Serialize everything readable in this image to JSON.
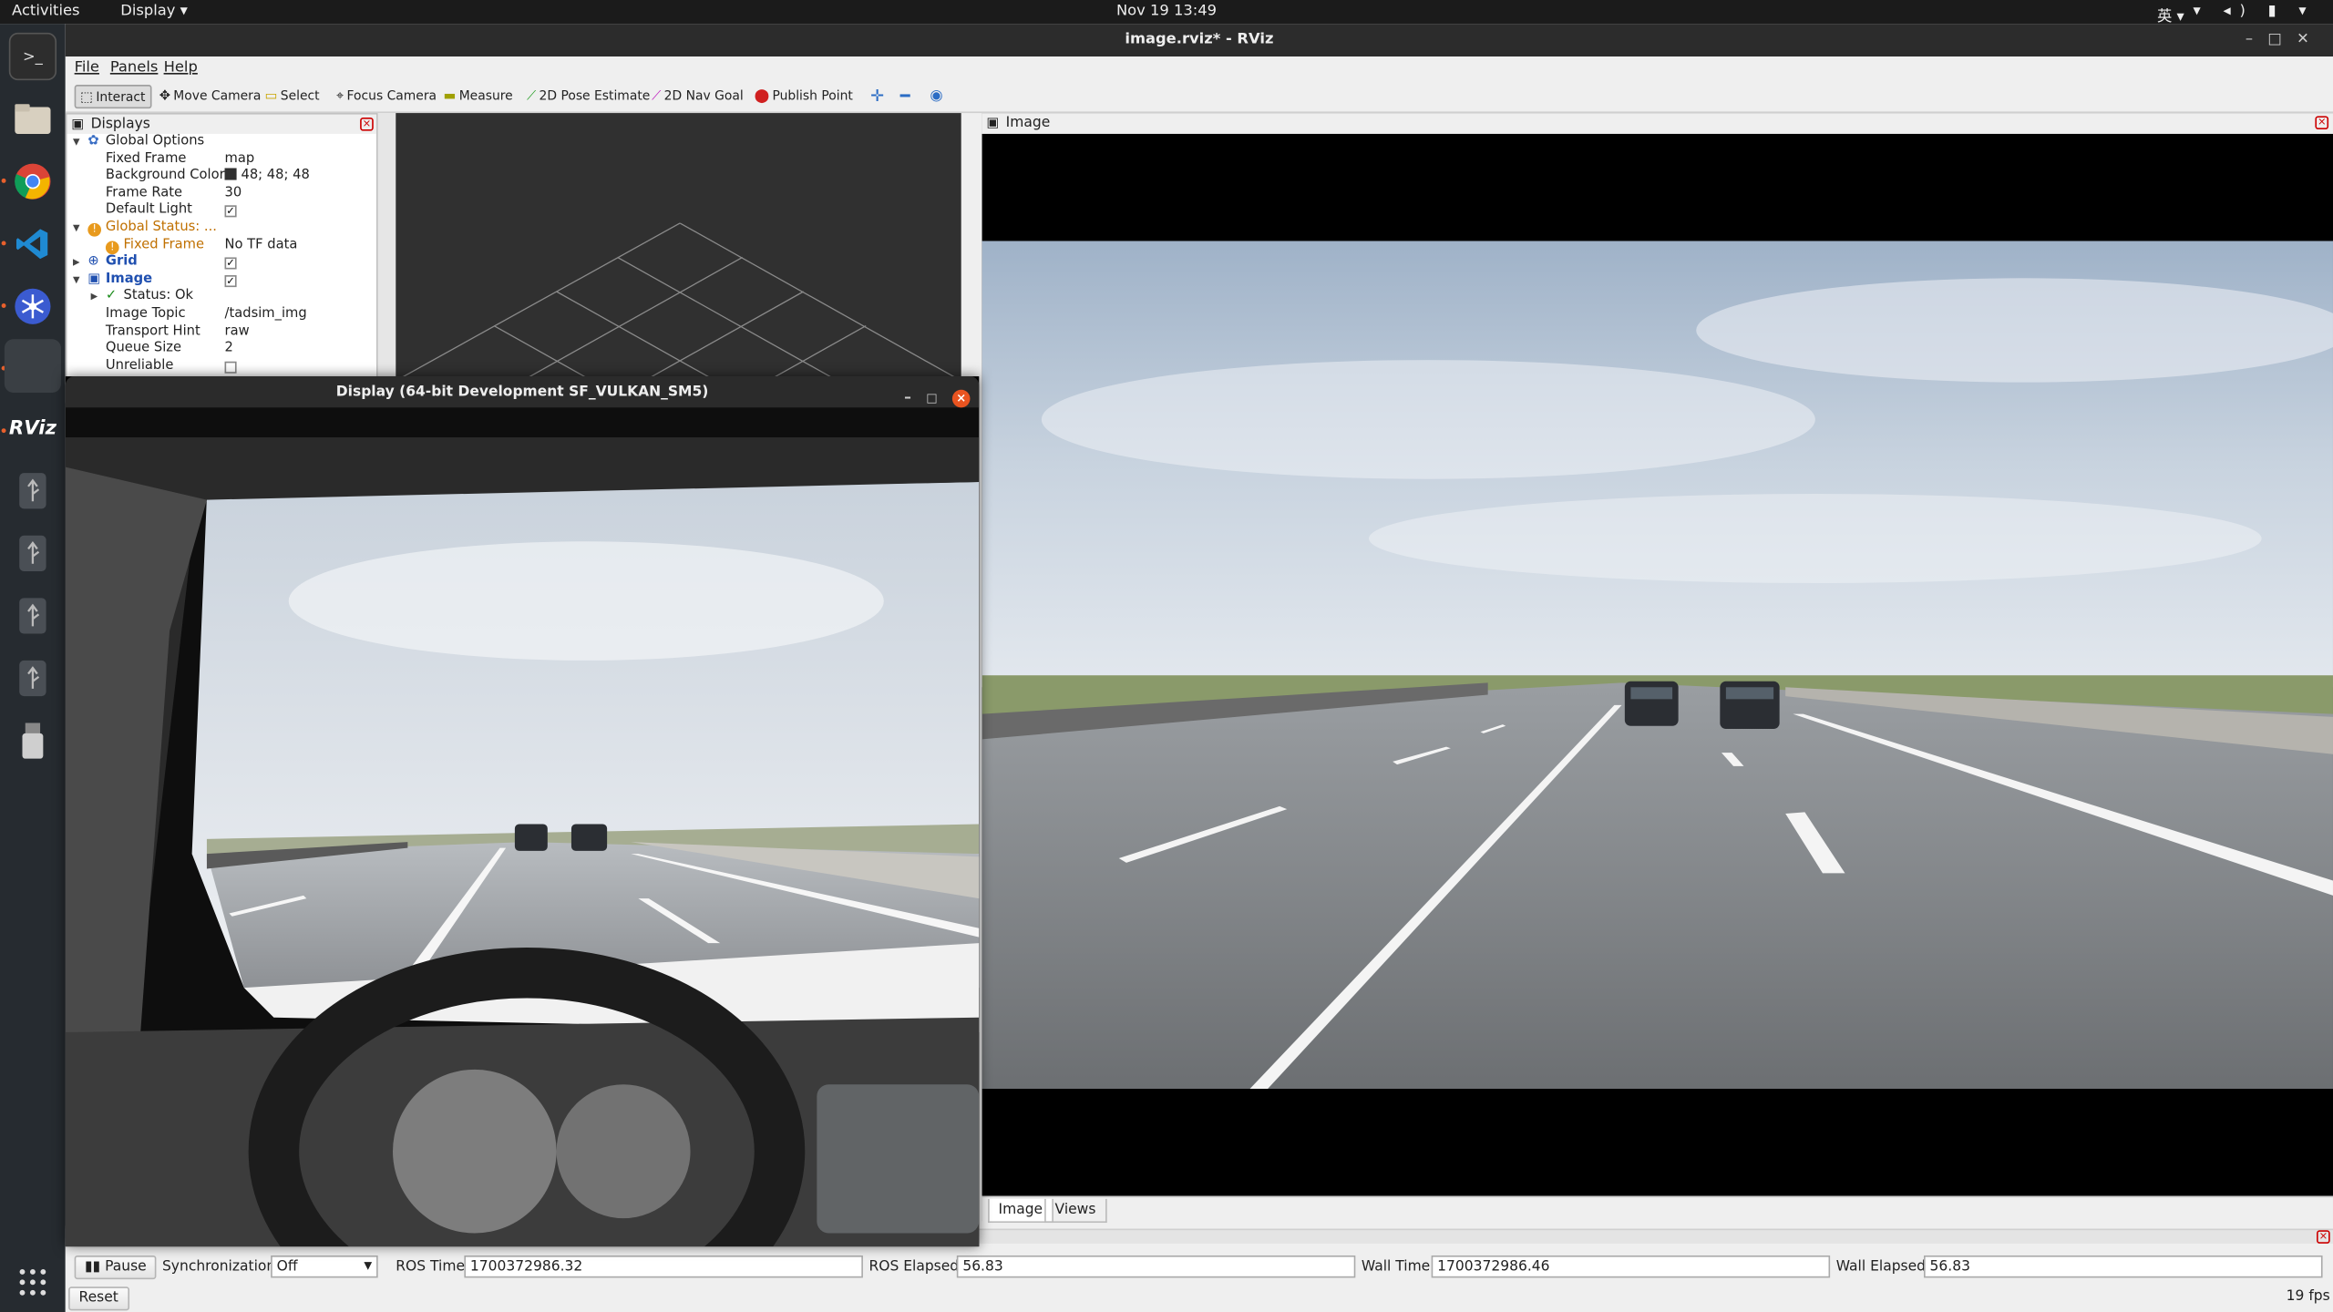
{
  "topbar": {
    "activities": "Activities",
    "app_menu": "Display ▾",
    "clock": "Nov 19  13:49",
    "ime": "英 ▾",
    "tray": "▾ ◂) ▮ ▾"
  },
  "dock": {
    "items": [
      "terminal-icon",
      "files-icon",
      "chrome-icon",
      "vscode-icon",
      "settings-icon",
      "blank-window-icon",
      "rviz-icon",
      "usb-icon",
      "usb-icon",
      "usb-icon",
      "usb-icon",
      "usb-drive-icon",
      "app-grid-icon"
    ],
    "rviz_label": "RViz"
  },
  "window": {
    "title": "image.rviz* - RViz"
  },
  "menu": {
    "file": "File",
    "panels": "Panels",
    "help": "Help"
  },
  "toolbar": {
    "interact": "Interact",
    "move_camera": "Move Camera",
    "select": "Select",
    "focus_camera": "Focus Camera",
    "measure": "Measure",
    "pose_estimate": "2D Pose Estimate",
    "nav_goal": "2D Nav Goal",
    "publish_point": "Publish Point"
  },
  "displays": {
    "title": "Displays",
    "global_options": "Global Options",
    "fixed_frame_key": "Fixed Frame",
    "fixed_frame_val": "map",
    "bg_key": "Background Color",
    "bg_val": "48; 48; 48",
    "frame_rate_key": "Frame Rate",
    "frame_rate_val": "30",
    "default_light_key": "Default Light",
    "global_status": "Global Status: ...",
    "status_fixed_frame": "Fixed Frame",
    "no_tf": "No TF data",
    "grid": "Grid",
    "image": "Image",
    "status_ok": "Status: Ok",
    "image_topic_key": "Image Topic",
    "image_topic_val": "/tadsim_img",
    "transport_key": "Transport Hint",
    "transport_val": "raw",
    "queue_key": "Queue Size",
    "queue_val": "2",
    "unreliable_key": "Unreliable"
  },
  "image_panel": {
    "title": "Image",
    "tab_image": "Image",
    "tab_views": "Views"
  },
  "time": {
    "pause": "Pause",
    "sync_label": "Synchronization:",
    "sync_value": "Off",
    "ros_time_label": "ROS Time:",
    "ros_time": "1700372986.32",
    "ros_elapsed_label": "ROS Elapsed:",
    "ros_elapsed": "56.83",
    "wall_time_label": "Wall Time:",
    "wall_time": "1700372986.46",
    "wall_elapsed_label": "Wall Elapsed:",
    "wall_elapsed": "56.83",
    "reset": "Reset",
    "fps": "19 fps"
  },
  "game_window": {
    "title": "Display (64-bit Development SF_VULKAN_SM5)"
  },
  "colors": {
    "rviz_bg": "#303030",
    "warning": "#c07000",
    "highlight": "#2050b0",
    "close_orange": "#e95420"
  }
}
